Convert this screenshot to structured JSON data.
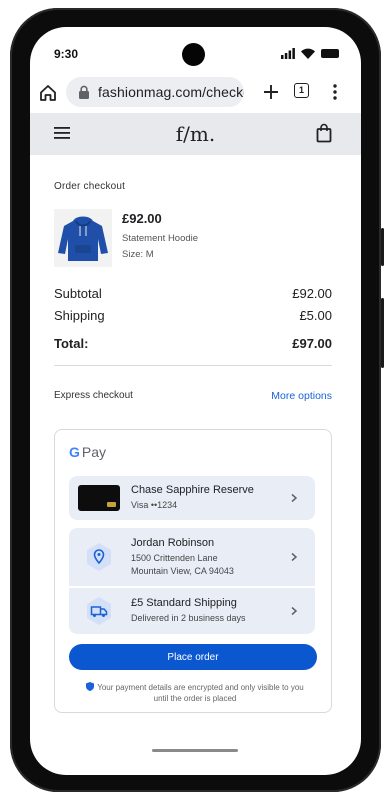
{
  "status": {
    "time": "9:30"
  },
  "browser": {
    "url": "fashionmag.com/checkout",
    "tab_count": "1"
  },
  "site": {
    "logo": "f/m."
  },
  "checkout": {
    "section_title": "Order checkout",
    "product": {
      "price": "£92.00",
      "name": "Statement Hoodie",
      "size": "Size: M",
      "image_color": "#1f4fa8"
    },
    "summary": [
      {
        "label": "Subtotal",
        "value": "£92.00"
      },
      {
        "label": "Shipping",
        "value": "£5.00"
      }
    ],
    "total": {
      "label": "Total:",
      "value": "£97.00"
    },
    "express_label": "Express checkout",
    "more_options": "More options"
  },
  "gpay": {
    "logo_g": "G",
    "logo_pay": "Pay",
    "card": {
      "title": "Chase Sapphire Reserve",
      "sub": "Visa ••1234"
    },
    "address": {
      "name": "Jordan Robinson",
      "line1": "1500 Crittenden Lane",
      "line2": "Mountain View, CA 94043"
    },
    "shipping": {
      "title": "£5 Standard Shipping",
      "sub": "Delivered in 2 business days"
    },
    "place_order": "Place order",
    "secure_note": "Your payment details are encrypted and only visible to you until the order is placed"
  },
  "colors": {
    "accent": "#0b57d0",
    "link": "#1a62d6",
    "row_bg": "#e9eef6",
    "header_bg": "#e8e9ec"
  }
}
